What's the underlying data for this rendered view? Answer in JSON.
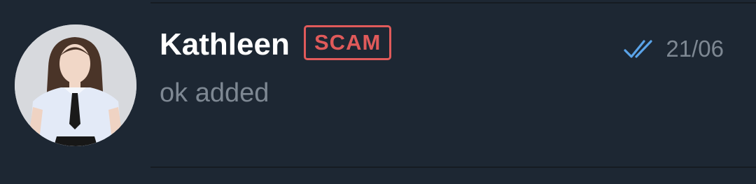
{
  "chat": {
    "name": "Kathleen",
    "badge": "SCAM",
    "last_message": "ok added",
    "date": "21/06",
    "read_status_icon": "double-check-icon",
    "avatar_icon": "user-avatar"
  },
  "colors": {
    "background": "#1d2733",
    "divider": "#161b22",
    "name": "#ffffff",
    "badge": "#e05a5a",
    "secondary_text": "#7e8893",
    "check": "#5aa3e8"
  }
}
